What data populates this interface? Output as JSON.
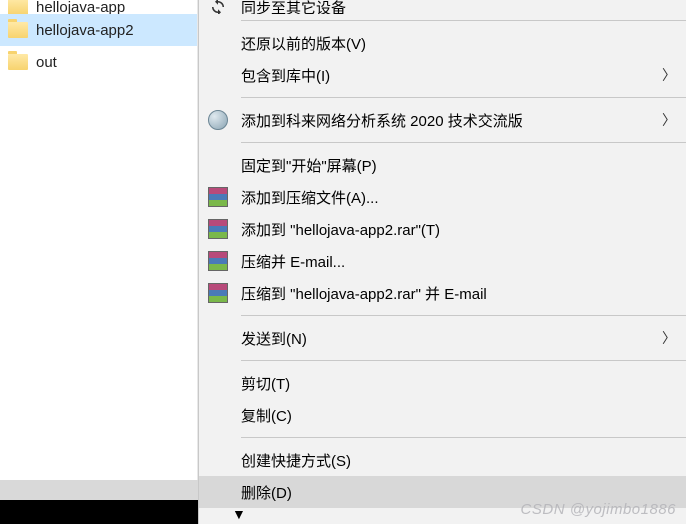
{
  "explorer": {
    "items": [
      {
        "label": "hellojava-app"
      },
      {
        "label": "hellojava-app2"
      },
      {
        "label": "out"
      }
    ]
  },
  "menu": {
    "sync": "同步至其它设备",
    "restore": "还原以前的版本(V)",
    "include": "包含到库中(I)",
    "colasoft": "添加到科来网络分析系统 2020 技术交流版",
    "pin": "固定到\"开始\"屏幕(P)",
    "rar_add": "添加到压缩文件(A)...",
    "rar_addname": "添加到 \"hellojava-app2.rar\"(T)",
    "rar_email": "压缩并 E-mail...",
    "rar_emailname": "压缩到 \"hellojava-app2.rar\" 并 E-mail",
    "sendto": "发送到(N)",
    "cut": "剪切(T)",
    "copy": "复制(C)",
    "shortcut": "创建快捷方式(S)",
    "delete": "删除(D)"
  },
  "watermark": "CSDN @yojimbo1886"
}
